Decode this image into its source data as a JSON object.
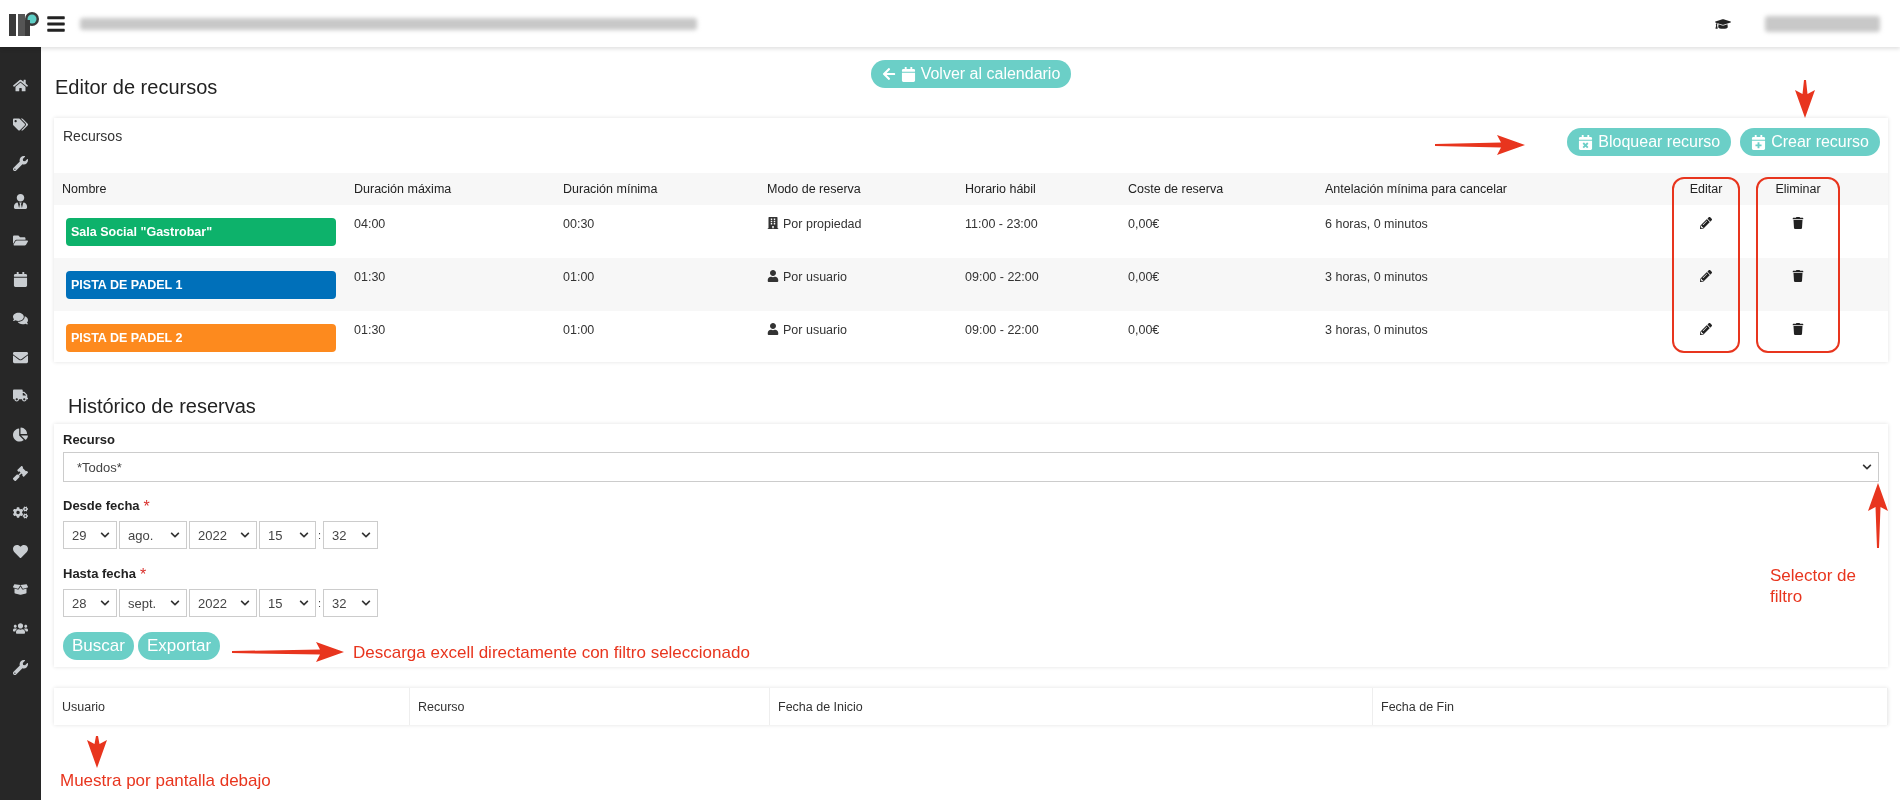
{
  "back_button": {
    "label": "Volver al calendario"
  },
  "title": "Editor de recursos",
  "resources": {
    "title": "Recursos",
    "buttons": [
      {
        "label": "Bloquear recurso",
        "kind": "block"
      },
      {
        "label": "Crear recurso",
        "kind": "create"
      }
    ],
    "columns": [
      "Nombre",
      "Duración máxima",
      "Duración mínima",
      "Modo de reserva",
      "Horario hábil",
      "Coste de reserva",
      "Antelación mínima para cancelar",
      "Editar",
      "Eliminar"
    ],
    "rows": [
      {
        "name": "Sala Social \"Gastrobar\"",
        "color": "#0db26b",
        "max": "04:00",
        "min": "00:30",
        "mode": "Por propiedad",
        "kind": "building",
        "hours": "11:00 - 23:00",
        "cost": "0,00€",
        "notice": "6 horas, 0 minutos"
      },
      {
        "name": "PISTA DE PADEL 1",
        "color": "#0070ba",
        "max": "01:30",
        "min": "01:00",
        "mode": "Por usuario",
        "kind": "user",
        "hours": "09:00 - 22:00",
        "cost": "0,00€",
        "notice": "3 horas, 0 minutos"
      },
      {
        "name": "PISTA DE PADEL 2",
        "color": "#fd8a1e",
        "max": "01:30",
        "min": "01:00",
        "mode": "Por usuario",
        "kind": "user",
        "hours": "09:00 - 22:00",
        "cost": "0,00€",
        "notice": "3 horas, 0 minutos"
      }
    ]
  },
  "history": {
    "title": "Histórico de reservas",
    "resource": {
      "label": "Recurso",
      "value": "*Todos*"
    },
    "dates": [
      {
        "label": "Desde fecha",
        "required_mark": "*",
        "day": "29",
        "month": "ago.",
        "year": "2022",
        "hour": "15",
        "separator": ":",
        "minute": "32"
      },
      {
        "label": "Hasta fecha",
        "required_mark": "*",
        "day": "28",
        "month": "sept.",
        "year": "2022",
        "hour": "15",
        "separator": ":",
        "minute": "32"
      }
    ],
    "buttons": [
      "Buscar",
      "Exportar"
    ],
    "results_columns": [
      "Usuario",
      "Recurso",
      "Fecha de Inicio",
      "Fecha de Fin"
    ]
  },
  "annotations": [
    {
      "text": "Selector de filtro"
    },
    {
      "text": "Descarga excell directamente con filtro seleccionado"
    },
    {
      "text": "Muestra por pantalla debajo"
    }
  ]
}
